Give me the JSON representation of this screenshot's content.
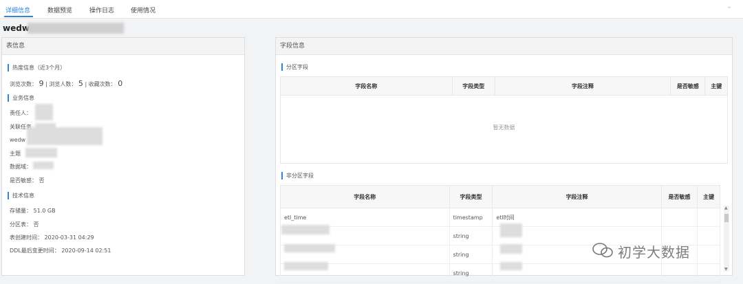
{
  "tabs": [
    {
      "label": "详细信息"
    },
    {
      "label": "数据预览"
    },
    {
      "label": "操作日志"
    },
    {
      "label": "使用情况"
    }
  ],
  "page_title_visible": "wedw",
  "table_info": {
    "header": "表信息",
    "hotness": {
      "section_label": "热度信息（近3个月）",
      "browse_label": "浏览次数：",
      "browse_count": "9",
      "visitors_label": "浏览人数：",
      "visitors_count": "5",
      "favorites_label": "收藏次数：",
      "favorites_count": "0"
    },
    "business": {
      "section_label": "业务信息",
      "owner_label": "责任人：",
      "related_task_label": "关联任务",
      "row_wedw": "wedw",
      "subject_label": "主题",
      "domain_label": "数据域：",
      "sensitive_label": "是否敏感：",
      "sensitive_value": "否"
    },
    "technical": {
      "section_label": "技术信息",
      "storage_label": "存储量：",
      "storage_value": "51.0 GB",
      "partition_label": "分区表：",
      "partition_value": "否",
      "created_label": "表创建时间：",
      "created_value": "2020-03-31 04:29",
      "ddl_label": "DDL最后变更时间：",
      "ddl_value": "2020-09-14 02:51"
    }
  },
  "field_info": {
    "header": "字段信息",
    "partition": {
      "section_label": "分区字段",
      "columns": [
        "字段名称",
        "字段类型",
        "字段注释",
        "是否敏感",
        "主键"
      ],
      "empty_text": "暂无数据"
    },
    "non_partition": {
      "section_label": "非分区字段",
      "columns": [
        "字段名称",
        "字段类型",
        "字段注释",
        "是否敏感",
        "主键"
      ],
      "rows": [
        {
          "name": "etl_time",
          "type": "timestamp",
          "comment": "etl时间"
        },
        {
          "name": "",
          "type": "string",
          "comment": ""
        },
        {
          "name": "",
          "type": "string",
          "comment": ""
        },
        {
          "name": "",
          "type": "string",
          "comment": ""
        }
      ]
    }
  },
  "watermark": "初学大数据"
}
